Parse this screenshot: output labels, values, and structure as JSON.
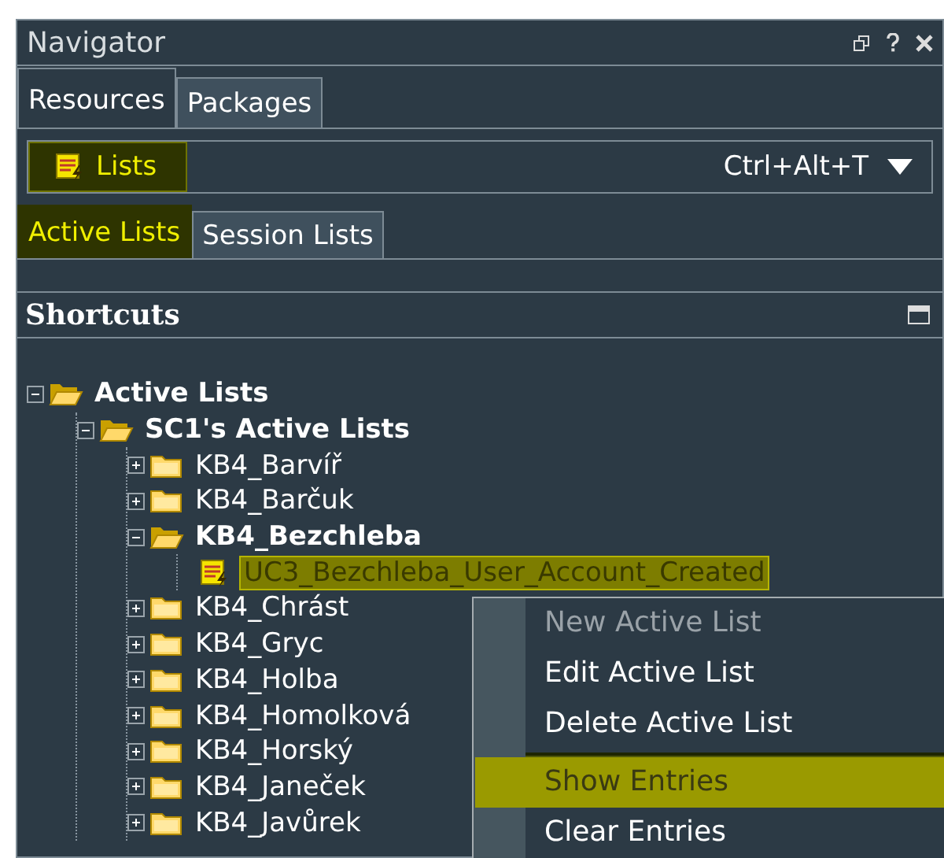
{
  "window": {
    "title": "Navigator"
  },
  "tabs": [
    {
      "label": "Resources",
      "selected": true
    },
    {
      "label": "Packages",
      "selected": false
    }
  ],
  "resource_selector": {
    "label": "Lists",
    "shortcut": "Ctrl+Alt+T"
  },
  "sub_tabs": [
    {
      "label": "Active Lists",
      "selected": true
    },
    {
      "label": "Session Lists",
      "selected": false
    }
  ],
  "shortcuts": {
    "title": "Shortcuts"
  },
  "tree": [
    {
      "label": "Active Lists",
      "kind": "folder",
      "expanded": true,
      "selected": false,
      "children": [
        {
          "label": "SC1's Active Lists",
          "kind": "folder",
          "expanded": true,
          "selected": false,
          "children": [
            {
              "label": "KB4_Barvíř",
              "kind": "folder",
              "expanded": false,
              "selected": false
            },
            {
              "label": "KB4_Barčuk",
              "kind": "folder",
              "expanded": false,
              "selected": false
            },
            {
              "label": "KB4_Bezchleba",
              "kind": "folder",
              "expanded": true,
              "selected": false,
              "children": [
                {
                  "label": "UC3_Bezchleba_User_Account_Created",
                  "kind": "list",
                  "selected": true
                }
              ]
            },
            {
              "label": "KB4_Chrást",
              "kind": "folder",
              "expanded": false,
              "selected": false
            },
            {
              "label": "KB4_Gryc",
              "kind": "folder",
              "expanded": false,
              "selected": false
            },
            {
              "label": "KB4_Holba",
              "kind": "folder",
              "expanded": false,
              "selected": false
            },
            {
              "label": "KB4_Homolková",
              "kind": "folder",
              "expanded": false,
              "selected": false
            },
            {
              "label": "KB4_Horský",
              "kind": "folder",
              "expanded": false,
              "selected": false
            },
            {
              "label": "KB4_Janeček",
              "kind": "folder",
              "expanded": false,
              "selected": false
            },
            {
              "label": "KB4_Javůrek",
              "kind": "folder",
              "expanded": false,
              "selected": false
            }
          ]
        }
      ]
    }
  ],
  "context_menu": [
    {
      "label": "New Active List",
      "disabled": true,
      "selected": false,
      "separator_after": false
    },
    {
      "label": "Edit Active List",
      "disabled": false,
      "selected": false,
      "separator_after": false
    },
    {
      "label": "Delete Active List",
      "disabled": false,
      "selected": false,
      "separator_after": true
    },
    {
      "label": "Show Entries",
      "disabled": false,
      "selected": true,
      "separator_after": false
    },
    {
      "label": "Clear Entries",
      "disabled": false,
      "selected": false,
      "separator_after": false
    }
  ]
}
